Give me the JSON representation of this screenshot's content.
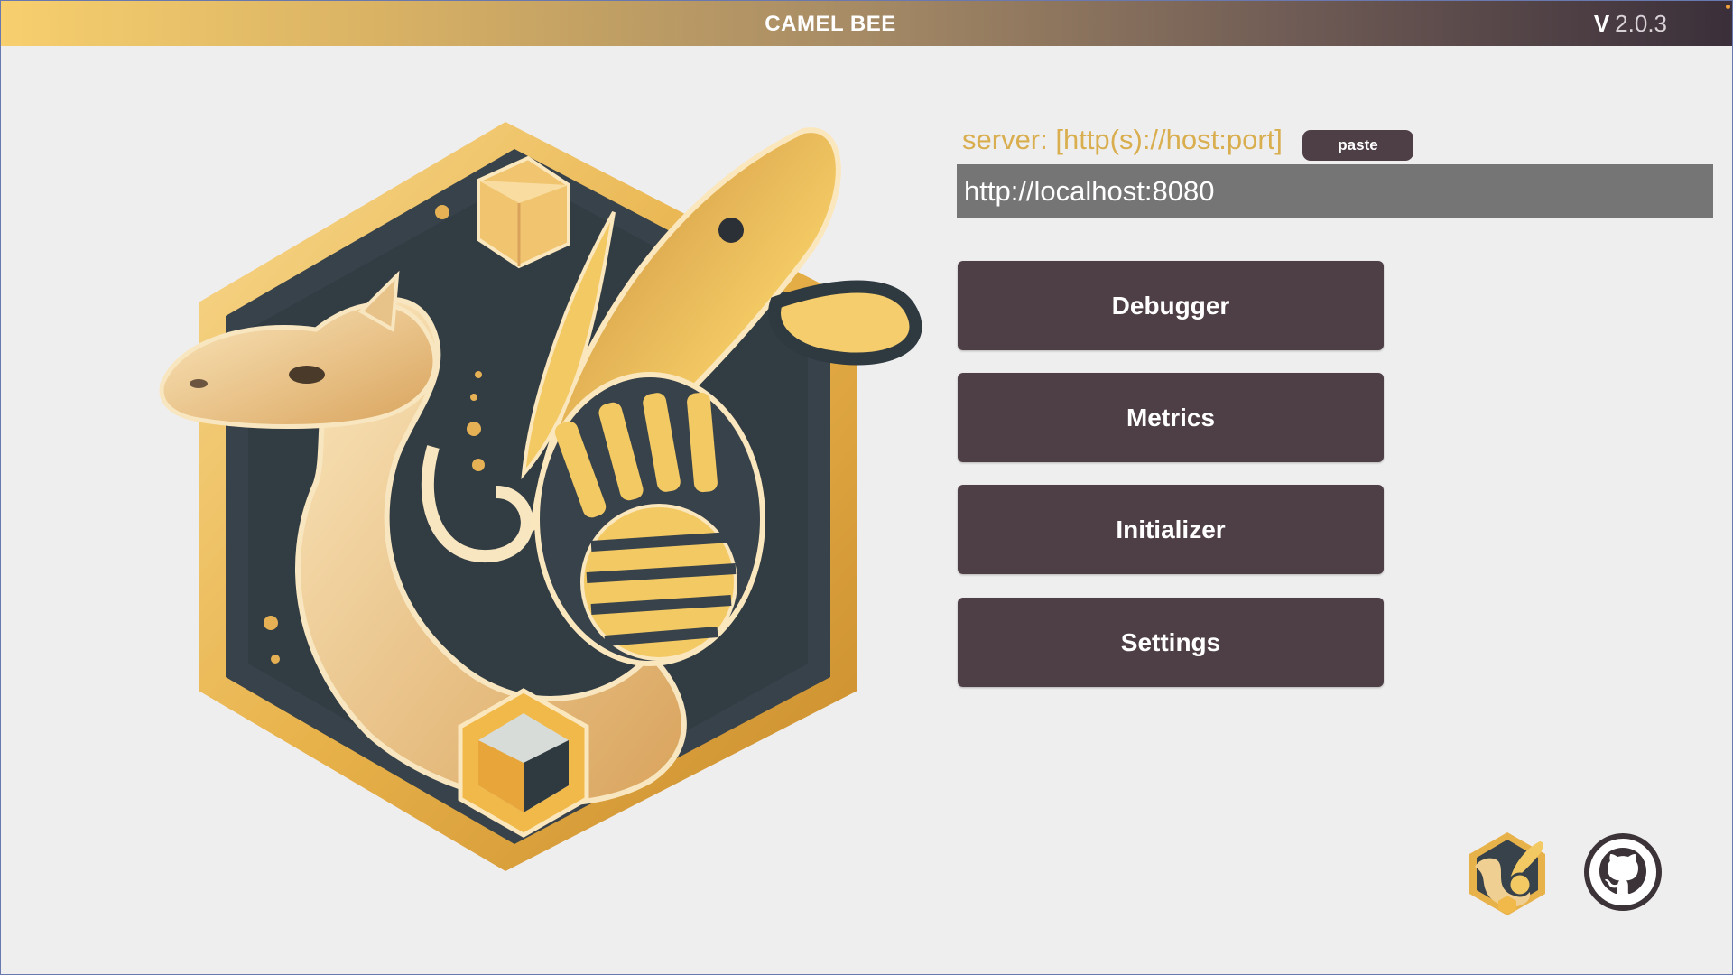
{
  "app": {
    "title": "CAMEL BEE",
    "version_prefix": "V",
    "version_number": "2.0.3"
  },
  "server": {
    "label": "server: [http(s)://host:port]",
    "paste_label": "paste",
    "value": "http://localhost:8080"
  },
  "menu": [
    {
      "label": "Debugger"
    },
    {
      "label": "Metrics"
    },
    {
      "label": "Initializer"
    },
    {
      "label": "Settings"
    }
  ],
  "footer": {
    "logo_icon": "camel-bee-logo-icon",
    "github_icon": "github-icon"
  },
  "colors": {
    "accent_gold": "#d9ae4f",
    "button_bg": "#4e3f46",
    "input_bg": "#767576",
    "background": "#efeeef"
  }
}
